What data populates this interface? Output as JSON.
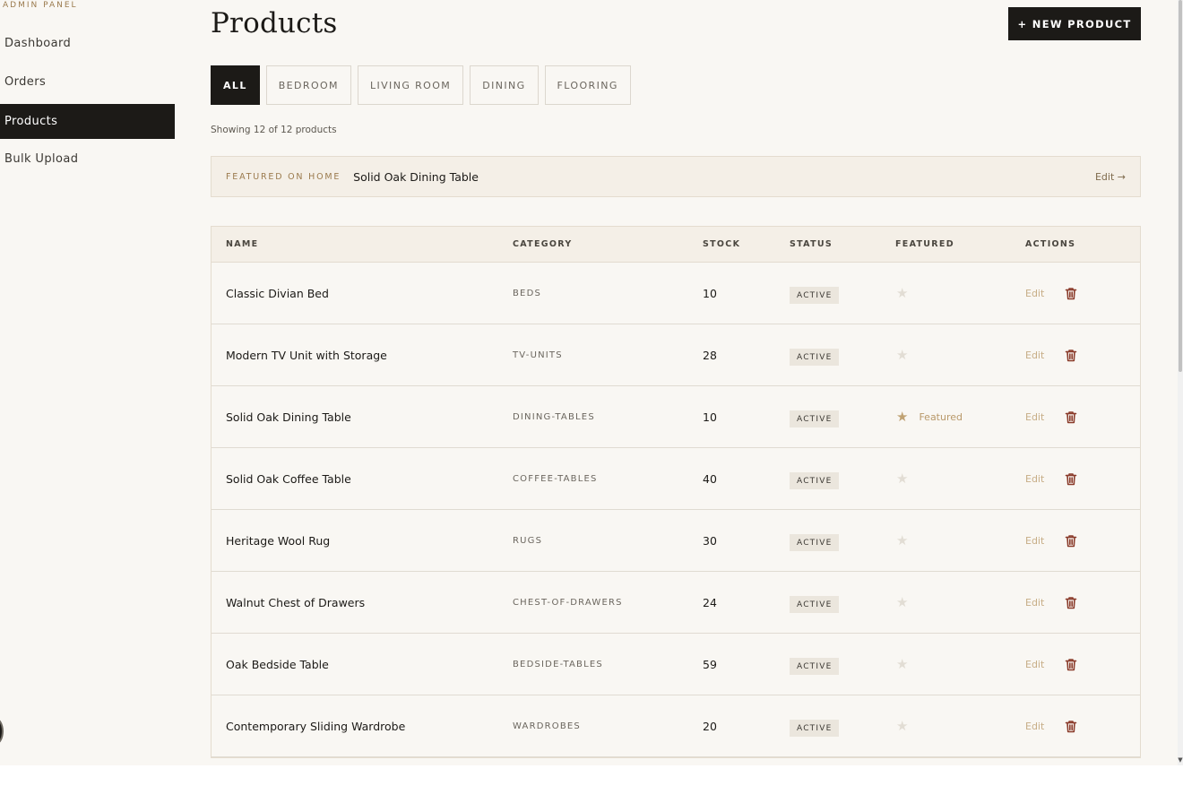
{
  "sidebar": {
    "brand": "ADMIN PANEL",
    "items": [
      {
        "label": "Dashboard"
      },
      {
        "label": "Orders"
      },
      {
        "label": "Products"
      },
      {
        "label": "Bulk Upload"
      }
    ],
    "active": "Products"
  },
  "header": {
    "title": "Products",
    "new_button": "+ NEW PRODUCT"
  },
  "filters": [
    "ALL",
    "BEDROOM",
    "LIVING ROOM",
    "DINING",
    "FLOORING"
  ],
  "active_filter": "ALL",
  "showing_text": "Showing 12 of 12 products",
  "featured": {
    "label": "FEATURED ON HOME",
    "product": "Solid Oak Dining Table",
    "edit": "Edit →"
  },
  "table": {
    "columns": [
      "NAME",
      "CATEGORY",
      "STOCK",
      "STATUS",
      "FEATURED",
      "ACTIONS"
    ],
    "edit_label": "Edit",
    "featured_label": "Featured",
    "rows": [
      {
        "name": "Classic Divian Bed",
        "category": "BEDS",
        "stock": "10",
        "status": "ACTIVE",
        "featured": false
      },
      {
        "name": "Modern TV Unit with Storage",
        "category": "TV-UNITS",
        "stock": "28",
        "status": "ACTIVE",
        "featured": false
      },
      {
        "name": "Solid Oak Dining Table",
        "category": "DINING-TABLES",
        "stock": "10",
        "status": "ACTIVE",
        "featured": true
      },
      {
        "name": "Solid Oak Coffee Table",
        "category": "COFFEE-TABLES",
        "stock": "40",
        "status": "ACTIVE",
        "featured": false
      },
      {
        "name": "Heritage Wool Rug",
        "category": "RUGS",
        "stock": "30",
        "status": "ACTIVE",
        "featured": false
      },
      {
        "name": "Walnut Chest of Drawers",
        "category": "CHEST-OF-DRAWERS",
        "stock": "24",
        "status": "ACTIVE",
        "featured": false
      },
      {
        "name": "Oak Bedside Table",
        "category": "BEDSIDE-TABLES",
        "stock": "59",
        "status": "ACTIVE",
        "featured": false
      },
      {
        "name": "Contemporary Sliding Wardrobe",
        "category": "WARDROBES",
        "stock": "20",
        "status": "ACTIVE",
        "featured": false
      }
    ]
  },
  "icons": {
    "star": "star-icon",
    "delete": "trash-icon"
  },
  "colors": {
    "accent_dark": "#1c1a17",
    "gold": "#c0a273",
    "delete_red": "#8a3b2a",
    "background": "#f9f7f3"
  }
}
